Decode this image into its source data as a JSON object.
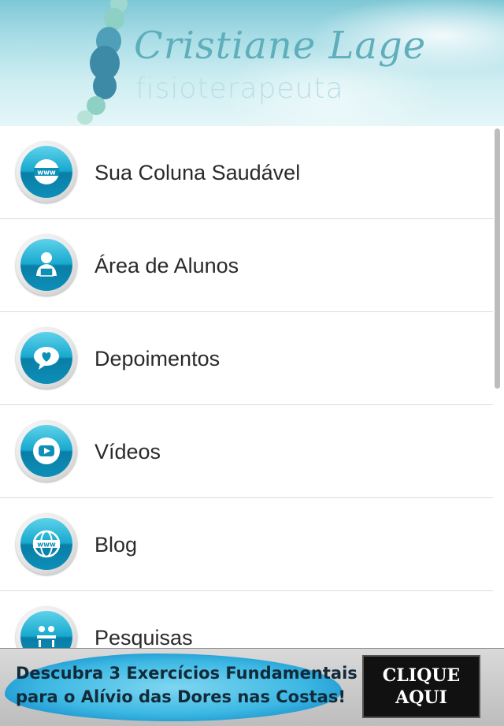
{
  "header": {
    "name": "Cristiane Lage",
    "subtitle": "fisioterapeuta"
  },
  "menu": {
    "items": [
      {
        "label": "Sua Coluna Saudável",
        "icon": "www-icon"
      },
      {
        "label": "Área de Alunos",
        "icon": "student-icon"
      },
      {
        "label": "Depoimentos",
        "icon": "chat-heart-icon"
      },
      {
        "label": "Vídeos",
        "icon": "video-play-icon"
      },
      {
        "label": "Blog",
        "icon": "globe-www-icon"
      },
      {
        "label": "Pesquisas",
        "icon": "survey-icon"
      }
    ]
  },
  "banner": {
    "line1": "Descubra 3 Exercícios Fundamentais",
    "line2": "para o Alívio das Dores nas Costas!",
    "cta_line1": "CLIQUE",
    "cta_line2": "AQUI"
  },
  "colors": {
    "accent": "#18a9cf",
    "header_text": "#5eaebb",
    "label_text": "#2a2a2a"
  }
}
